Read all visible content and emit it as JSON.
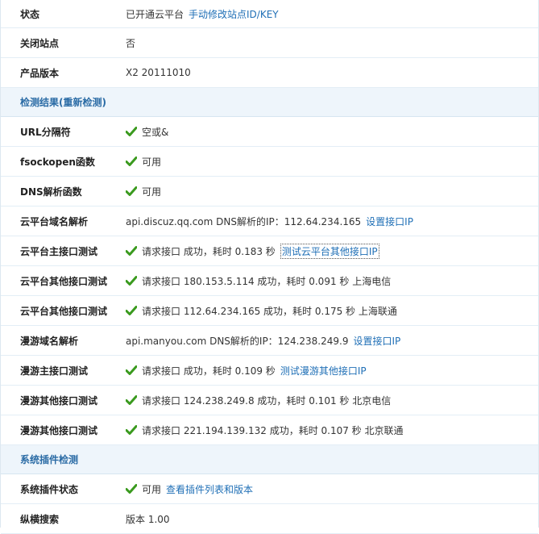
{
  "rows_top": [
    {
      "label": "状态",
      "text": "已开通云平台",
      "link": "手动修改站点ID/KEY"
    },
    {
      "label": "关闭站点",
      "text": "否"
    },
    {
      "label": "产品版本",
      "text": "X2 20111010"
    }
  ],
  "section_check": {
    "title": "检测结果(重新检测)"
  },
  "rows_check": [
    {
      "label": "URL分隔符",
      "ok": true,
      "text": "空或&"
    },
    {
      "label": "fsockopen函数",
      "ok": true,
      "text": "可用"
    },
    {
      "label": "DNS解析函数",
      "ok": true,
      "text": "可用"
    },
    {
      "label": "云平台域名解析",
      "ok": false,
      "text": "api.discuz.qq.com DNS解析的IP：112.64.234.165",
      "link": "设置接口IP"
    },
    {
      "label": "云平台主接口测试",
      "ok": true,
      "text": "请求接口 成功，耗时 0.183 秒",
      "link": "测试云平台其他接口IP",
      "link_focused": true
    },
    {
      "label": "云平台其他接口测试",
      "ok": true,
      "text": "请求接口 180.153.5.114 成功，耗时 0.091 秒 上海电信"
    },
    {
      "label": "云平台其他接口测试",
      "ok": true,
      "text": "请求接口 112.64.234.165 成功，耗时 0.175 秒 上海联通"
    },
    {
      "label": "漫游域名解析",
      "ok": false,
      "text": "api.manyou.com DNS解析的IP：124.238.249.9",
      "link": "设置接口IP"
    },
    {
      "label": "漫游主接口测试",
      "ok": true,
      "text": "请求接口 成功，耗时 0.109 秒",
      "link": "测试漫游其他接口IP"
    },
    {
      "label": "漫游其他接口测试",
      "ok": true,
      "text": "请求接口 124.238.249.8 成功，耗时 0.101 秒 北京电信"
    },
    {
      "label": "漫游其他接口测试",
      "ok": true,
      "text": "请求接口 221.194.139.132 成功，耗时 0.107 秒 北京联通"
    }
  ],
  "section_plugins": {
    "title": "系统插件检测"
  },
  "rows_plugins": [
    {
      "label": "系统插件状态",
      "ok": true,
      "text": "可用",
      "link": "查看插件列表和版本"
    },
    {
      "label": "纵横搜索",
      "ok": false,
      "text": "版本 1.00"
    }
  ],
  "colors": {
    "accent": "#1f6fb6",
    "section_bg": "#eef5fb",
    "section_title": "#2a6ba5",
    "check_green": "#3a9a1e"
  },
  "icons": {
    "ok": "check-icon"
  }
}
